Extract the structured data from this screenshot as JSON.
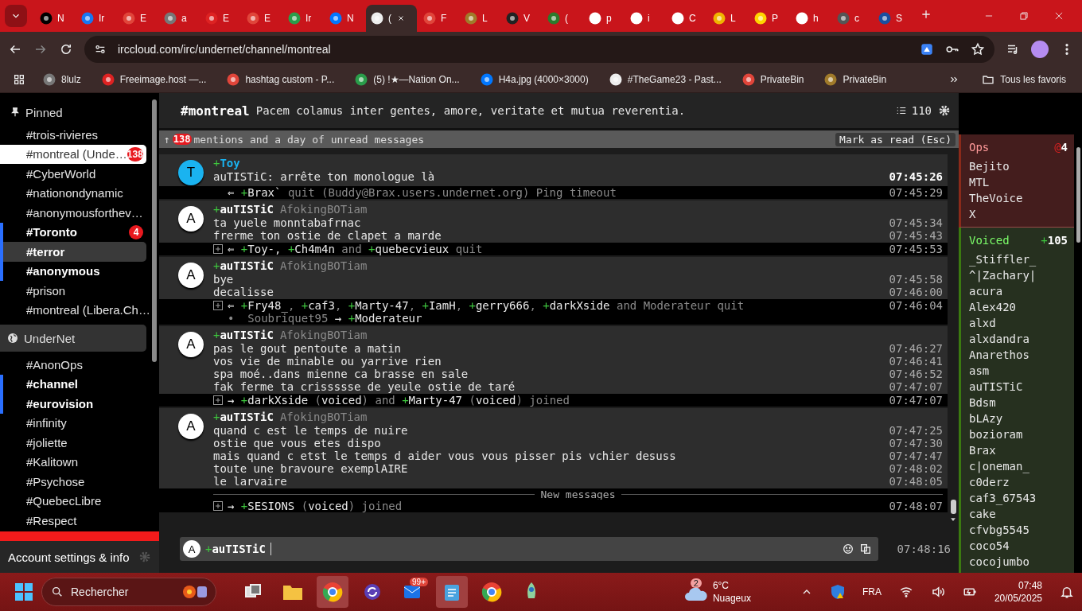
{
  "browser": {
    "tabs": [
      {
        "label": "N",
        "selected": false
      },
      {
        "label": "Ir",
        "selected": false
      },
      {
        "label": "E",
        "selected": false
      },
      {
        "label": "a",
        "selected": false
      },
      {
        "label": "E",
        "selected": false
      },
      {
        "label": "E",
        "selected": false
      },
      {
        "label": "Ir",
        "selected": false
      },
      {
        "label": "N",
        "selected": false
      },
      {
        "label": "(",
        "selected": true
      },
      {
        "label": "F",
        "selected": false
      },
      {
        "label": "L",
        "selected": false
      },
      {
        "label": "V",
        "selected": false
      },
      {
        "label": "(",
        "selected": false
      },
      {
        "label": "p",
        "selected": false
      },
      {
        "label": "i",
        "selected": false
      },
      {
        "label": "C",
        "selected": false
      },
      {
        "label": "L",
        "selected": false
      },
      {
        "label": "P",
        "selected": false
      },
      {
        "label": "h",
        "selected": false
      },
      {
        "label": "c",
        "selected": false
      },
      {
        "label": "S",
        "selected": false
      }
    ],
    "address": "irccloud.com/irc/undernet/channel/montreal",
    "bookmarks": [
      {
        "label": "8lulz"
      },
      {
        "label": "Freeimage.host —..."
      },
      {
        "label": "hashtag custom - P..."
      },
      {
        "label": "(5) !★—Nation On..."
      },
      {
        "label": "H4a.jpg (4000×3000)"
      },
      {
        "label": "#TheGame23 - Past..."
      },
      {
        "label": "PrivateBin"
      },
      {
        "label": "PrivateBin"
      }
    ],
    "all_bookmarks": "Tous les favoris"
  },
  "sidebar": {
    "pinned_title": "Pinned",
    "pinned": [
      {
        "name": "#trois-rivieres",
        "unread": false,
        "selected": false,
        "focused": false
      },
      {
        "name": "#montreal (Unde…",
        "unread": false,
        "selected": true,
        "focused": false,
        "badge": "138"
      },
      {
        "name": "#CyberWorld",
        "unread": false,
        "selected": false,
        "focused": false
      },
      {
        "name": "#nationondynamic",
        "unread": false,
        "selected": false,
        "focused": false
      },
      {
        "name": "#anonymousforthev…",
        "unread": false,
        "selected": false,
        "focused": false
      },
      {
        "name": "#Toronto",
        "unread": true,
        "selected": false,
        "focused": false,
        "badge": "4"
      },
      {
        "name": "#terror",
        "unread": true,
        "selected": false,
        "focused": true
      },
      {
        "name": "#anonymous",
        "unread": true,
        "selected": false,
        "focused": false
      },
      {
        "name": "#prison",
        "unread": false,
        "selected": false,
        "focused": false
      },
      {
        "name": "#montreal (Libera.Ch…",
        "unread": false,
        "selected": false,
        "focused": false
      }
    ],
    "network": "UnderNet",
    "channels": [
      {
        "name": "#AnonOps",
        "unread": false,
        "selected": false,
        "focused": false
      },
      {
        "name": "#channel",
        "unread": true,
        "selected": false,
        "focused": false
      },
      {
        "name": "#eurovision",
        "unread": true,
        "selected": false,
        "focused": false
      },
      {
        "name": "#infinity",
        "unread": false,
        "selected": false,
        "focused": false
      },
      {
        "name": "#joliette",
        "unread": false,
        "selected": false,
        "focused": false
      },
      {
        "name": "#Kalitown",
        "unread": false,
        "selected": false,
        "focused": false
      },
      {
        "name": "#Psychose",
        "unread": false,
        "selected": false,
        "focused": false
      },
      {
        "name": "#QuebecLibre",
        "unread": false,
        "selected": false,
        "focused": false
      },
      {
        "name": "#Respect",
        "unread": false,
        "selected": false,
        "focused": false
      }
    ],
    "account": "Account settings & info"
  },
  "channel": {
    "name": "#montreal",
    "topic": "Pacem colamus inter gentes, amore, veritate et mutua reverentia.",
    "member_count": "110"
  },
  "unread_bar": {
    "arrow": "↑",
    "count": "138",
    "text": "mentions and a day of unread messages",
    "button": "Mark as read (Esc)"
  },
  "messages": [
    {
      "kind": "message",
      "avatar": "T",
      "color": "#1ab3f0",
      "plus": "+",
      "nick": "Toy",
      "lines": [
        {
          "text": "auTISTiC: arrête ton monologue là",
          "time": "07:45:26",
          "highlight": true
        }
      ]
    },
    {
      "kind": "event",
      "expandable": false,
      "segments": [
        {
          "kind": "arrow",
          "text": "⇐ "
        },
        {
          "kind": "plus",
          "text": "+"
        },
        {
          "kind": "nick",
          "text": "Brax`"
        },
        {
          "kind": "muted",
          "text": " quit (Buddy@Brax.users.undernet.org) Ping timeout"
        }
      ],
      "time": "07:45:29"
    },
    {
      "kind": "message",
      "avatar": "A",
      "color": "#ffffff",
      "plus": "+",
      "nick": "auTISTiC",
      "realname": "AfokingBOTiam",
      "lines": [
        {
          "text": "ta yuele monntabafrnac",
          "time": "07:45:34",
          "highlight": false
        },
        {
          "text": "frerme ton ostie de clapet a marde",
          "time": "07:45:43",
          "highlight": false
        }
      ]
    },
    {
      "kind": "event",
      "expandable": true,
      "segments": [
        {
          "kind": "arrow",
          "text": "⇐ "
        },
        {
          "kind": "plus",
          "text": "+"
        },
        {
          "kind": "nick",
          "text": "Toy-"
        },
        {
          "kind": "nick",
          "text": ", "
        },
        {
          "kind": "plus",
          "text": "+"
        },
        {
          "kind": "nick",
          "text": "Ch4m4n"
        },
        {
          "kind": "muted",
          "text": " and "
        },
        {
          "kind": "plus",
          "text": "+"
        },
        {
          "kind": "nick",
          "text": "quebecvieux"
        },
        {
          "kind": "muted",
          "text": " quit"
        }
      ],
      "time": "07:45:53"
    },
    {
      "kind": "message",
      "avatar": "A",
      "color": "#ffffff",
      "plus": "+",
      "nick": "auTISTiC",
      "realname": "AfokingBOTiam",
      "lines": [
        {
          "text": "bye",
          "time": "07:45:58",
          "highlight": false
        },
        {
          "text": "decalisse",
          "time": "07:46:00",
          "highlight": false
        }
      ]
    },
    {
      "kind": "event",
      "expandable": true,
      "segments": [
        {
          "kind": "arrow",
          "text": "⇐ "
        },
        {
          "kind": "plus",
          "text": "+"
        },
        {
          "kind": "nick",
          "text": "Fry48_"
        },
        {
          "kind": "muted",
          "text": ", "
        },
        {
          "kind": "plus",
          "text": "+"
        },
        {
          "kind": "nick",
          "text": "caf3"
        },
        {
          "kind": "muted",
          "text": ", "
        },
        {
          "kind": "plus",
          "text": "+"
        },
        {
          "kind": "nick",
          "text": "Marty-47"
        },
        {
          "kind": "muted",
          "text": ", "
        },
        {
          "kind": "plus",
          "text": "+"
        },
        {
          "kind": "nick",
          "text": "IamH"
        },
        {
          "kind": "muted",
          "text": ", "
        },
        {
          "kind": "plus",
          "text": "+"
        },
        {
          "kind": "nick",
          "text": "gerry666"
        },
        {
          "kind": "muted",
          "text": ", "
        },
        {
          "kind": "plus",
          "text": "+"
        },
        {
          "kind": "nick",
          "text": "darkXside"
        },
        {
          "kind": "muted",
          "text": " and Moderateur quit  •  Soubriquet95 "
        },
        {
          "kind": "arrow",
          "text": "→ "
        },
        {
          "kind": "plus",
          "text": "+"
        },
        {
          "kind": "nick",
          "text": "Moderateur"
        }
      ],
      "time": "07:46:04"
    },
    {
      "kind": "message",
      "avatar": "A",
      "color": "#ffffff",
      "plus": "+",
      "nick": "auTISTiC",
      "realname": "AfokingBOTiam",
      "lines": [
        {
          "text": "pas le gout pentoute a matin",
          "time": "07:46:27",
          "highlight": false
        },
        {
          "text": "vos vie de minable ou yarrive rien",
          "time": "07:46:41",
          "highlight": false
        },
        {
          "text": "spa moé..dans mienne ca brasse en sale",
          "time": "07:46:52",
          "highlight": false
        },
        {
          "text": "fak ferme ta crissssse de yeule ostie de taré",
          "time": "07:47:07",
          "highlight": false
        }
      ]
    },
    {
      "kind": "event",
      "expandable": true,
      "segments": [
        {
          "kind": "arrow",
          "text": "→ "
        },
        {
          "kind": "plus",
          "text": "+"
        },
        {
          "kind": "nick",
          "text": "darkXside"
        },
        {
          "kind": "muted",
          "text": " ("
        },
        {
          "kind": "nick",
          "text": "voiced"
        },
        {
          "kind": "muted",
          "text": ") and "
        },
        {
          "kind": "plus",
          "text": "+"
        },
        {
          "kind": "nick",
          "text": "Marty-47"
        },
        {
          "kind": "muted",
          "text": " ("
        },
        {
          "kind": "nick",
          "text": "voiced"
        },
        {
          "kind": "muted",
          "text": ") joined"
        }
      ],
      "time": "07:47:07"
    },
    {
      "kind": "message",
      "avatar": "A",
      "color": "#ffffff",
      "plus": "+",
      "nick": "auTISTiC",
      "realname": "AfokingBOTiam",
      "lines": [
        {
          "text": "quand c est le temps de nuire",
          "time": "07:47:25",
          "highlight": false
        },
        {
          "text": "ostie que vous etes dispo",
          "time": "07:47:30",
          "highlight": false
        },
        {
          "text": "mais quand c etst le temps d aider vous vous pisser pis vchier desuss",
          "time": "07:47:47",
          "highlight": false
        },
        {
          "text": "toute une bravoure exemplAIRE",
          "time": "07:48:02",
          "highlight": false
        },
        {
          "text": "le larvaire",
          "time": "07:48:05",
          "highlight": false
        }
      ]
    },
    {
      "kind": "divider",
      "label": "New messages"
    },
    {
      "kind": "event",
      "expandable": true,
      "segments": [
        {
          "kind": "arrow",
          "text": "→ "
        },
        {
          "kind": "plus",
          "text": "+"
        },
        {
          "kind": "nick",
          "text": "SESIONS"
        },
        {
          "kind": "muted",
          "text": " ("
        },
        {
          "kind": "nick",
          "text": "voiced"
        },
        {
          "kind": "muted",
          "text": ") joined"
        }
      ],
      "time": "07:48:07"
    }
  ],
  "input": {
    "avatar": "A",
    "plus": "+",
    "nick": "auTISTiC",
    "time": "07:48:16"
  },
  "members": [
    {
      "kind": "ops",
      "title": "Ops",
      "symbol": "@",
      "count": "4",
      "names": [
        "Bejito",
        "MTL",
        "TheVoice",
        "X"
      ]
    },
    {
      "kind": "voiced",
      "title": "Voiced",
      "symbol": "+",
      "count": "105",
      "names": [
        "_Stiffler_",
        "^|Zachary|",
        "acura",
        "Alex420",
        "alxd",
        "alxdandra",
        "Anarethos",
        "asm",
        "auTISTiC",
        "Bdsm",
        "bLAzy",
        "bozioram",
        "Brax",
        "c|oneman_",
        "c0derz",
        "caf3_67543",
        "cake",
        "cfvbg5545",
        "coco54",
        "cocojumbo"
      ]
    }
  ],
  "taskbar": {
    "search_placeholder": "Rechercher",
    "mail_badge": "99+",
    "weather_badge": "2",
    "temperature": "6°C",
    "condition": "Nuageux",
    "language": "FRA",
    "time": "07:48",
    "date": "20/05/2025"
  }
}
